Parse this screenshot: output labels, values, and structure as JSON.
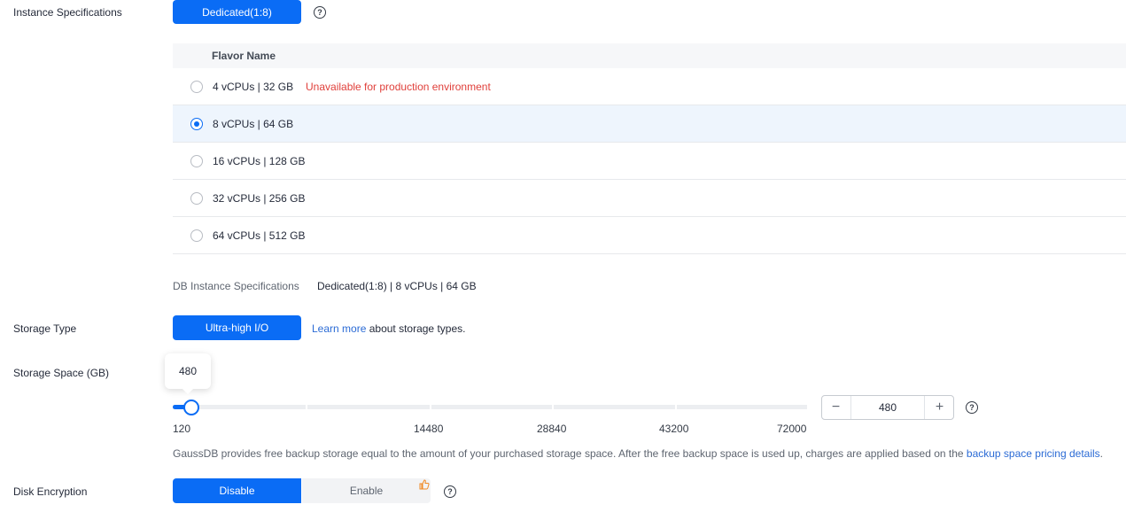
{
  "instance_specs": {
    "label": "Instance Specifications",
    "button_label": "Dedicated(1:8)",
    "help_icon": "question-circle-icon"
  },
  "flavor_table": {
    "header": "Flavor Name",
    "rows": [
      {
        "name": "4 vCPUs | 32 GB",
        "note": "Unavailable for production environment",
        "selected": false
      },
      {
        "name": "8 vCPUs | 64 GB",
        "note": "",
        "selected": true
      },
      {
        "name": "16 vCPUs | 128 GB",
        "note": "",
        "selected": false
      },
      {
        "name": "32 vCPUs | 256 GB",
        "note": "",
        "selected": false
      },
      {
        "name": "64 vCPUs | 512 GB",
        "note": "",
        "selected": false
      }
    ]
  },
  "db_spec": {
    "label": "DB Instance Specifications",
    "value": "Dedicated(1:8) | 8 vCPUs | 64 GB"
  },
  "storage_type": {
    "label": "Storage Type",
    "button_label": "Ultra-high I/O",
    "learn_more": "Learn more",
    "suffix": "about storage types."
  },
  "storage_space": {
    "label": "Storage Space (GB)",
    "tooltip": "480",
    "value": "480",
    "min": 120,
    "max": 72000,
    "current": 480,
    "ticks": [
      "120",
      "14480",
      "28840",
      "43200",
      "72000"
    ],
    "minus": "−",
    "plus": "+",
    "note_prefix": "GaussDB provides free backup storage equal to the amount of your purchased storage space. After the free backup space is used up, charges are applied based on the ",
    "note_link": "backup space pricing details",
    "note_suffix": "."
  },
  "disk_encryption": {
    "label": "Disk Encryption",
    "disable_label": "Disable",
    "enable_label": "Enable",
    "enable_badge_icon": "thumbs-up-icon"
  },
  "colors": {
    "primary": "#0a6cf5",
    "link": "#2b6bd5",
    "error": "#e0403b"
  }
}
